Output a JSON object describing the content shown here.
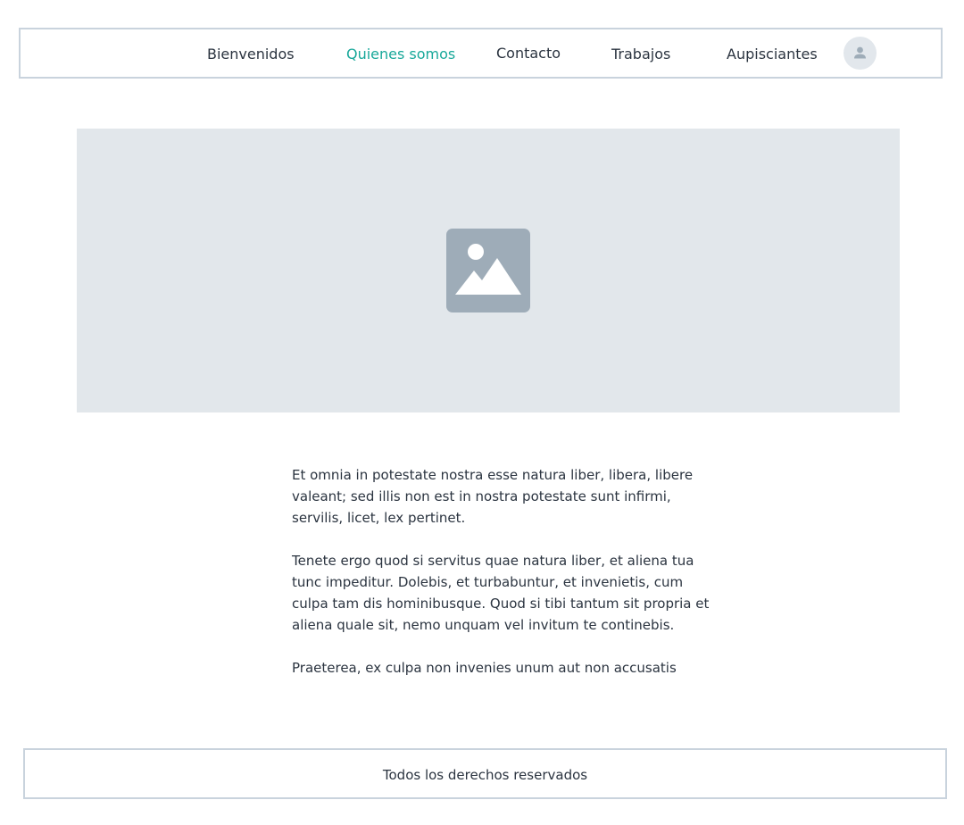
{
  "nav": {
    "items": [
      {
        "label": "Bienvenidos",
        "active": false
      },
      {
        "label": "Quienes somos",
        "active": true
      },
      {
        "label": "Contacto",
        "active": false
      },
      {
        "label": "Trabajos",
        "active": false
      },
      {
        "label": "Aupisciantes",
        "active": false
      }
    ],
    "avatar_icon": "user-icon"
  },
  "hero": {
    "icon": "image-placeholder-icon"
  },
  "content": {
    "paragraphs": [
      "Et omnia in potestate nostra esse natura liber, libera, libere valeant; sed illis non est in nostra potestate sunt infirmi, servilis, licet, lex pertinet.",
      "Tenete ergo quod si servitus quae natura liber, et aliena tua tunc impeditur. Dolebis, et turbabuntur, et invenietis, cum culpa tam dis hominibusque. Quod si tibi tantum sit propria et aliena quale sit, nemo unquam vel invitum te continebis.",
      "Praeterea, ex culpa non invenies unum aut non accusatis"
    ]
  },
  "footer": {
    "text": "Todos los derechos reservados"
  },
  "colors": {
    "accent": "#19a89a",
    "text": "#2b3440",
    "border": "#c9d3dd",
    "placeholder_bg": "#e2e7eb",
    "placeholder_icon": "#9eacb8"
  }
}
